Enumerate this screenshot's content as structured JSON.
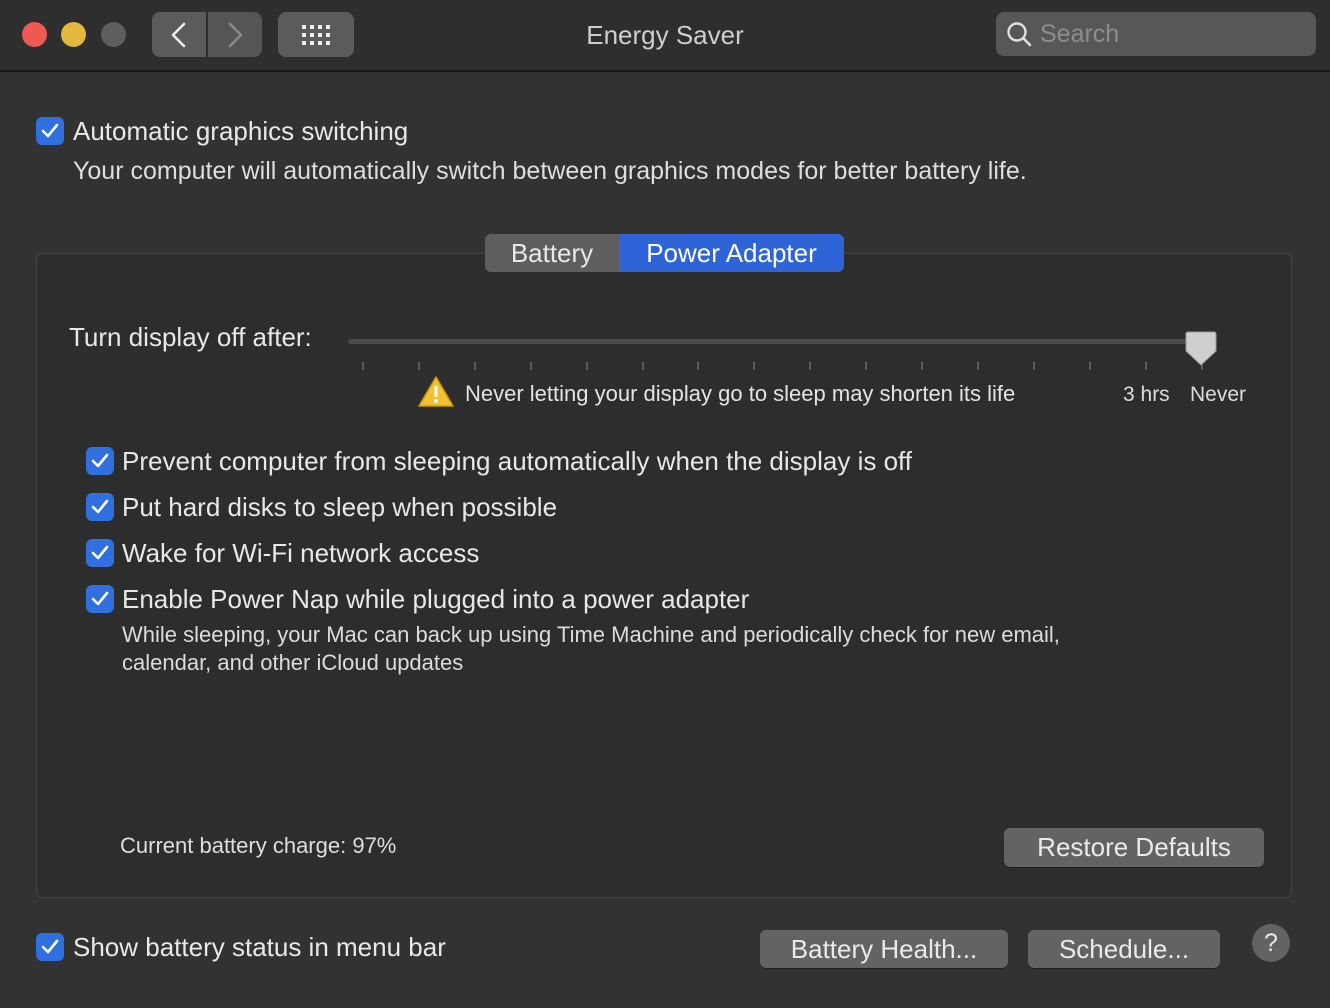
{
  "window": {
    "title": "Energy Saver"
  },
  "search": {
    "placeholder": "Search"
  },
  "graphics": {
    "checkbox_label": "Automatic graphics switching",
    "checked": true,
    "description": "Your computer will automatically switch between graphics modes for better battery life."
  },
  "tabs": [
    {
      "label": "Battery",
      "selected": false
    },
    {
      "label": "Power Adapter",
      "selected": true
    }
  ],
  "display_off": {
    "label": "Turn display off after:",
    "value": "Never",
    "tick_labels": {
      "three_hrs": "3 hrs",
      "never": "Never"
    },
    "warning": "Never letting your display go to sleep may shorten its life"
  },
  "options": [
    {
      "label": "Prevent computer from sleeping automatically when the display is off",
      "checked": true
    },
    {
      "label": "Put hard disks to sleep when possible",
      "checked": true
    },
    {
      "label": "Wake for Wi-Fi network access",
      "checked": true
    },
    {
      "label": "Enable Power Nap while plugged into a power adapter",
      "checked": true
    }
  ],
  "power_nap_note": {
    "line1": "While sleeping, your Mac can back up using Time Machine and periodically check for new email,",
    "line2": "calendar, and other iCloud updates"
  },
  "battery_charge": "Current battery charge: 97%",
  "buttons": {
    "restore_defaults": "Restore Defaults",
    "battery_health": "Battery Health...",
    "schedule": "Schedule...",
    "help": "?"
  },
  "menu_bar": {
    "label": "Show battery status in menu bar",
    "checked": true
  },
  "colors": {
    "accent": "#2e64d8",
    "background": "#323232",
    "warning": "#f2c232"
  }
}
